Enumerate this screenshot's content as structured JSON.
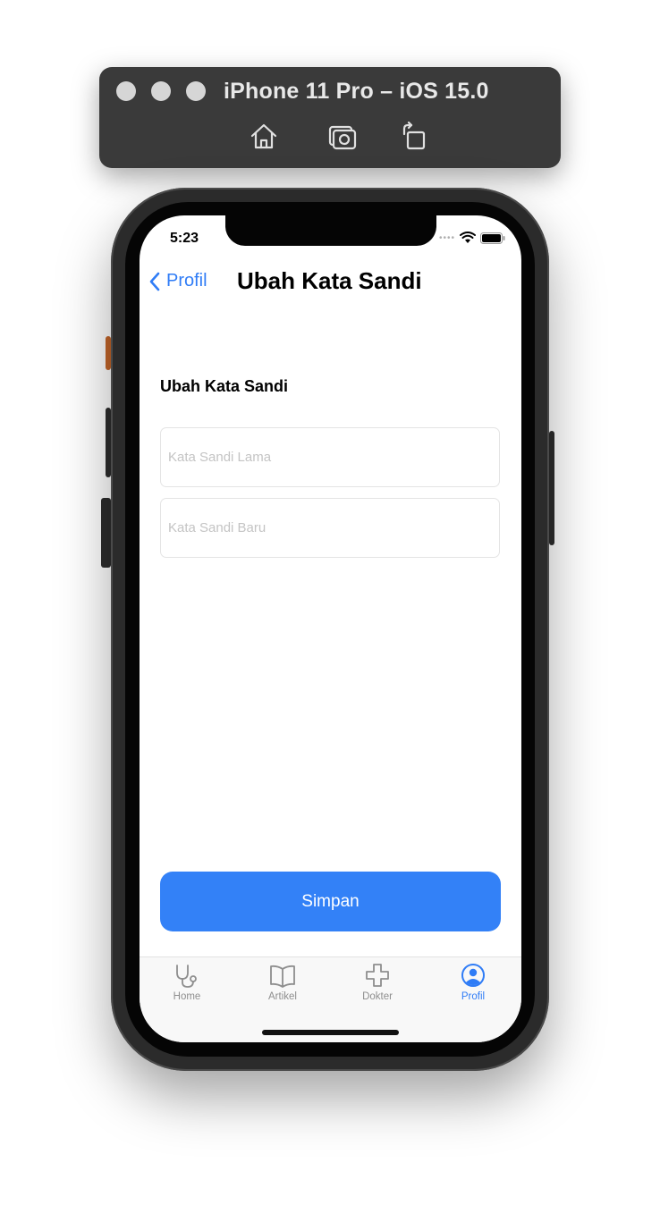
{
  "simulator": {
    "title": "iPhone 11 Pro – iOS 15.0",
    "toolbar": [
      "home-icon",
      "screenshot-icon",
      "rotate-icon"
    ]
  },
  "status_bar": {
    "time": "5:23"
  },
  "nav": {
    "back_label": "Profil",
    "title": "Ubah Kata Sandi"
  },
  "form": {
    "section_label": "Ubah Kata Sandi",
    "old_password": {
      "placeholder": "Kata Sandi Lama",
      "value": ""
    },
    "new_password": {
      "placeholder": "Kata Sandi Baru",
      "value": ""
    },
    "save_label": "Simpan"
  },
  "tabs": [
    {
      "label": "Home",
      "icon": "stethoscope-icon",
      "active": false
    },
    {
      "label": "Artikel",
      "icon": "book-icon",
      "active": false
    },
    {
      "label": "Dokter",
      "icon": "medical-cross-icon",
      "active": false
    },
    {
      "label": "Profil",
      "icon": "person-circle-icon",
      "active": true
    }
  ],
  "colors": {
    "accent": "#3381f7",
    "tab_inactive": "#8e8e8e"
  }
}
